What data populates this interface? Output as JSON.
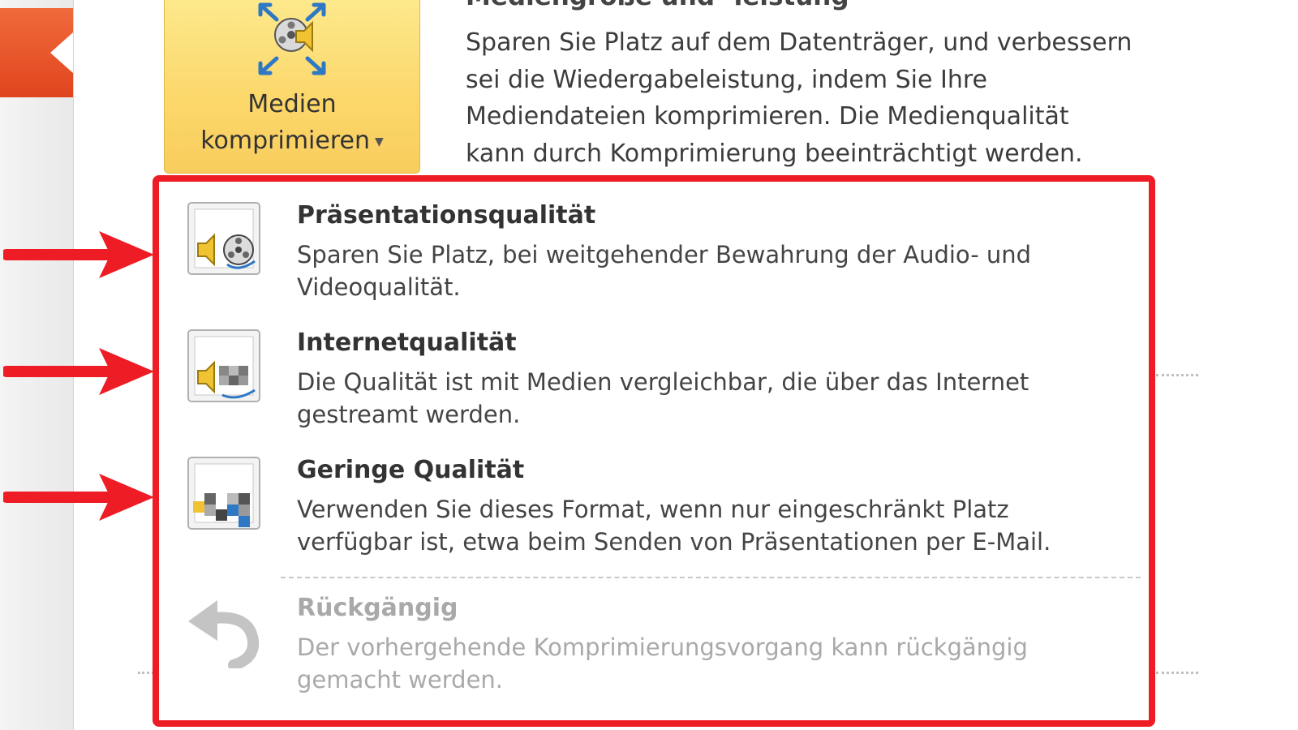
{
  "ribbon": {
    "compress_button": {
      "line1": "Medien",
      "line2": "komprimieren",
      "icon": "compress-media-icon",
      "state": "highlighted"
    }
  },
  "section": {
    "title": "Mediengröße und -leistung",
    "description_lines": [
      "Sparen Sie Platz auf dem Datenträger, und verbessern",
      "sei die Wiedergabeleistung, indem Sie Ihre",
      "Mediendateien komprimieren. Die Medienqualität",
      "kann durch Komprimierung beeinträchtigt werden."
    ]
  },
  "menu": {
    "items": [
      {
        "title": "Präsentationsqualität",
        "desc_lines": [
          "Sparen Sie Platz, bei weitgehender Bewahrung der Audio- und",
          "Videoqualität."
        ],
        "icon": "presentation-quality-icon",
        "enabled": true
      },
      {
        "title": "Internetqualität",
        "desc_lines": [
          "Die Qualität ist mit Medien vergleichbar, die über das Internet",
          "gestreamt werden."
        ],
        "icon": "internet-quality-icon",
        "enabled": true
      },
      {
        "title": "Geringe Qualität",
        "desc_lines": [
          "Verwenden Sie dieses Format, wenn nur eingeschränkt Platz",
          "verfügbar ist, etwa beim Senden von Präsentationen per E-Mail."
        ],
        "icon": "low-quality-icon",
        "enabled": true
      },
      {
        "title": "Rückgängig",
        "desc_lines": [
          "Der vorhergehende Komprimierungsvorgang kann rückgängig",
          "gemacht werden."
        ],
        "icon": "undo-icon",
        "enabled": false
      }
    ]
  },
  "colors": {
    "highlight_border": "#ee1c24",
    "button_gold": "#fcd76a",
    "tab_accent": "#e8512a",
    "disabled_text": "#a9a9a9"
  }
}
